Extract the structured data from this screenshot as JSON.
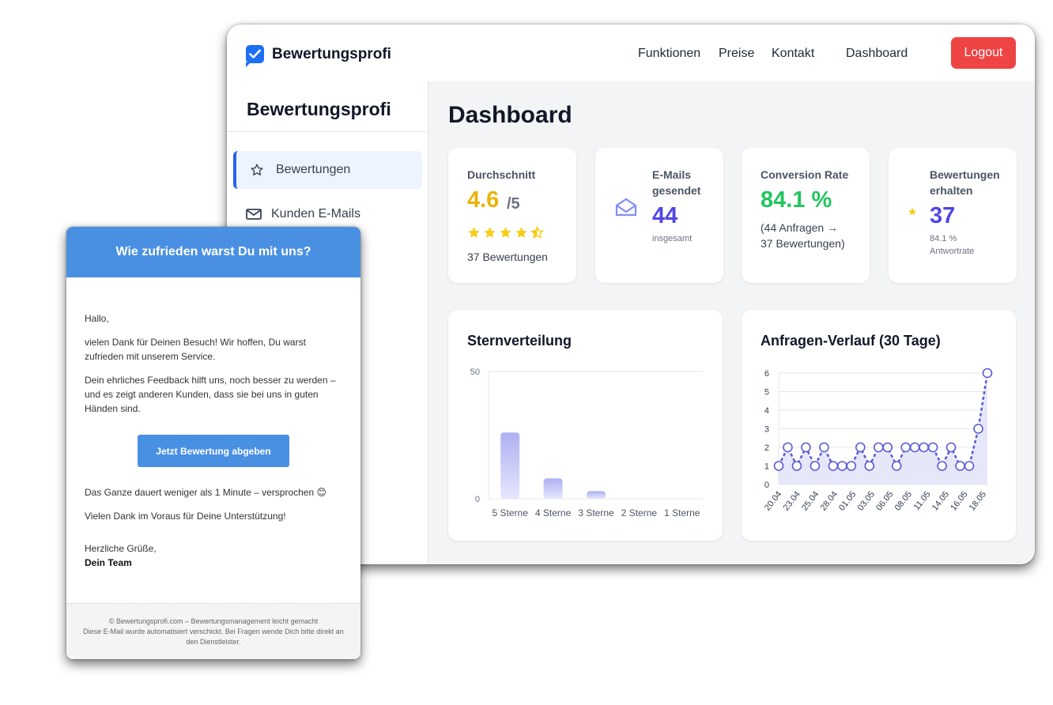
{
  "topbar": {
    "logo_text": "Bewertungsprofi",
    "nav": [
      "Funktionen",
      "Preise",
      "Kontakt",
      "Dashboard"
    ],
    "logout_label": "Logout"
  },
  "sidebar": {
    "title": "Bewertungsprofi",
    "items": [
      {
        "label": "Bewertungen",
        "icon": "star-outline-icon",
        "active": true
      },
      {
        "label": "Kunden E-Mails",
        "icon": "mail-icon",
        "active": false
      }
    ]
  },
  "main": {
    "title": "Dashboard",
    "kpis": {
      "average": {
        "label": "Durchschnitt",
        "value": "4.6",
        "suffix": "/5",
        "stars": 4.5,
        "sub": "37 Bewertungen"
      },
      "emails": {
        "label_line1": "E-Mails",
        "label_line2": "gesendet",
        "value": "44",
        "sub": "insgesamt"
      },
      "conversion": {
        "label": "Conversion Rate",
        "value": "84.1 %",
        "sub_line1": "(44 Anfragen →",
        "sub_line2": "37 Bewertungen)"
      },
      "reviews": {
        "label_line1": "Bewertungen",
        "label_line2": "erhalten",
        "value": "37",
        "sub_line1": "84.1 %",
        "sub_line2": "Antwortrate"
      }
    }
  },
  "colors": {
    "accent": "#2563eb",
    "average": "#eab308",
    "emails": "#4f46e5",
    "conversion": "#22c55e",
    "reviews": "#4f46e5",
    "logout": "#ef4444",
    "email_header": "#4a90e2",
    "chart_line": "#5b5bd6"
  },
  "chart_data": [
    {
      "type": "bar",
      "title": "Sternverteilung",
      "categories": [
        "5 Sterne",
        "4 Sterne",
        "3 Sterne",
        "2 Sterne",
        "1 Sterne"
      ],
      "values": [
        26,
        8,
        3,
        0,
        0
      ],
      "ylim": [
        0,
        50
      ],
      "yticks": [
        0,
        50
      ],
      "grid": true
    },
    {
      "type": "line",
      "title": "Anfragen-Verlauf (30 Tage)",
      "x": [
        "20.04",
        "21.04",
        "22.04",
        "23.04",
        "24.04",
        "25.04",
        "26.04",
        "27.04",
        "28.04",
        "29.04",
        "30.04",
        "01.05",
        "02.05",
        "03.05",
        "04.05",
        "05.05",
        "06.05",
        "07.05",
        "08.05",
        "09.05",
        "10.05",
        "11.05",
        "12.05",
        "13.05",
        "14.05",
        "15.05",
        "16.05",
        "17.05",
        "18.05",
        "19.05"
      ],
      "xtick_labels": [
        "20.04",
        "23.04",
        "25.04",
        "28.04",
        "01.05",
        "03.05",
        "06.05",
        "08.05",
        "11.05",
        "14.05",
        "16.05",
        "18.05"
      ],
      "values": [
        1,
        2,
        1,
        2,
        1,
        2,
        1,
        1,
        1,
        2,
        1,
        2,
        2,
        1,
        2,
        2,
        2,
        2,
        1,
        2,
        1,
        1,
        3,
        6
      ],
      "ylim": [
        0,
        6
      ],
      "yticks": [
        0,
        1,
        2,
        3,
        4,
        5,
        6
      ],
      "fill": true,
      "grid": true
    }
  ],
  "email": {
    "header": "Wie zufrieden warst Du mit uns?",
    "greeting": "Hallo,",
    "para1": "vielen Dank für Deinen Besuch! Wir hoffen, Du warst zufrieden mit unserem Service.",
    "para2": "Dein ehrliches Feedback hilft uns, noch besser zu werden – und es zeigt anderen Kunden, dass sie bei uns in guten Händen sind.",
    "cta": "Jetzt Bewertung abgeben",
    "para3": "Das Ganze dauert weniger als 1 Minute – versprochen 😊",
    "para4": "Vielen Dank im Voraus für Deine Unterstützung!",
    "closing": "Herzliche Grüße,",
    "signature": "Dein Team",
    "footer_line1": "© Bewertungsprofi.com – Bewertungsmanagement leicht gemacht",
    "footer_line2": "Diese E-Mail wurde automatisiert verschickt. Bei Fragen wende Dich bitte direkt an den Dienstleister."
  }
}
